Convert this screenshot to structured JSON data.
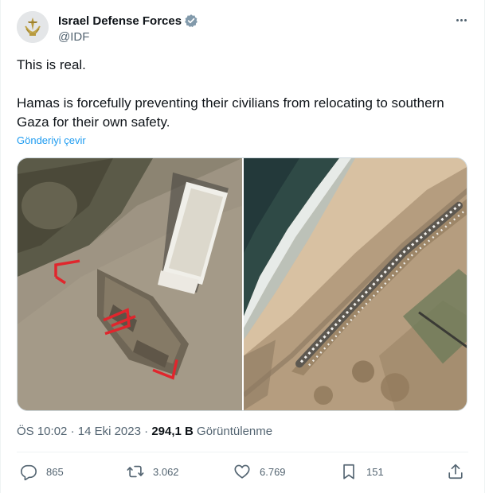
{
  "author": {
    "name": "Israel Defense Forces",
    "handle": "@IDF",
    "verified_color": "#829aab"
  },
  "tweet": {
    "paragraphs": [
      "This is real.",
      "Hamas is forcefully preventing their civilians from relocating to southern Gaza for their own safety."
    ],
    "translate_label": "Gönderiyi çevir"
  },
  "media": {
    "left_image_icon": "satellite-roadblock-image",
    "right_image_icon": "satellite-traffic-image",
    "highlight_color": "#e0262d"
  },
  "meta": {
    "time": "ÖS 10:02",
    "separator": "·",
    "date": "14 Eki 2023",
    "views_count": "294,1 B",
    "views_label": "Görüntülenme"
  },
  "actions": {
    "replies": "865",
    "reposts": "3.062",
    "likes": "6.769",
    "bookmarks": "151"
  },
  "colors": {
    "text_primary": "#0f1419",
    "text_secondary": "#536471",
    "link": "#1d9bf0"
  }
}
